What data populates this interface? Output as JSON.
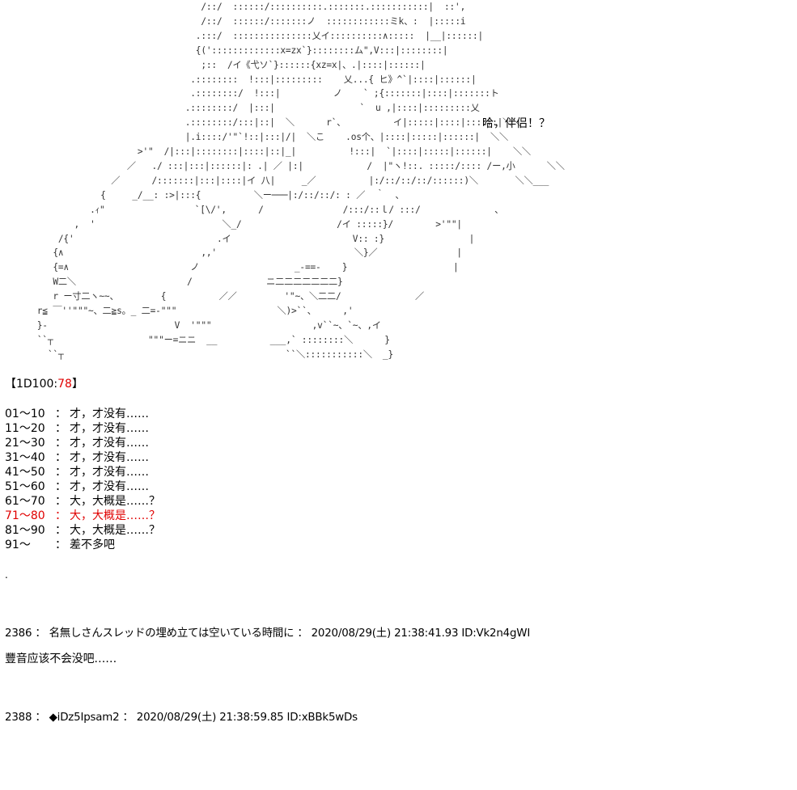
{
  "ascii_art": "                                      /::/  ::::::/::::::::::.:::::::.:::::::::::|  ::',\n                                      /::/  ::::::/:::::::ノ  ::::::::::::ミk、:  |:::::i\n                                     .:::/  :::::::::::::::乂イ::::::::::∧:::::  |__|::::::|\n                                     {(':::::::::::::x=zx`}::::::::ム\",V:::|::::::::|\n                                      ;::  /イ《弋ソ`}::::::{xz=x|、.|::::|::::::|\n                                    .::::::::  !:::|:::::::::    乂...{ ヒ》^`|::::|::::::|\n                                    .::::::::/  !:::|          ノ    ` ;{:::::::|::::|:::::::ト\n                                   .::::::::/  |:::|                `  u ,|::::|:::::::::乂\n                                   .::::::::/:::|::|  ＼      r`、         イ|:::::|::::|::::::|＼＼\n                                   |.i::::/'\"`!::|:::|/|  ＼こ    .os个、|::::|:::::|::::::|  ＼＼\n                          >'\"  /|:::|::::::::|::::|::|_|          !:::|  `|::::|:::::|::::::|    ＼＼\n                        ／   ./ :::|:::|::::::|: .| ／ |:|            /  |\"ヽ!::. :::::/:::: /ー,小      ＼＼\n                     ／      /:::::::|:::|::::|イ 八|     _／          |:/::/::/::/::::::)＼       ＼＼___\n                   {     _/__: :>|:::{          ＼ー───|:/::/::/: : ／  ｀  、\n                 .ｨ\"                 `[\\/',      /               /:::/::ｌ/ :::/              、\n              ,  '                        ＼_/                  /イ :::::}/        >'\"\"|\n           /{'                           .イ                       V:: :}                |\n          {∧                          ,,'                          ＼}／               |\n          {=∧                       ノ                  _-==-    }                    |\n          W二＼                     /              ニ二二二二二二二}\n          r ー寸二ヽ~~、        {          ／／         '\"~、＼二二/              ／\n       r≦ ￣''\"\"\"~、二≧s。_ 二=-\"\"\"                   ＼)>``、     ,'\n       }-                        V  '\"\"\"                   ,v``~、`~、,イ\n       ``┬                  \"\"\"ー=ニニ  __          ___,` ::::::::＼      }\n         ``┬                                          ``＼:::::::::::＼  _}",
  "speech": "哈，伴侣！？",
  "roll": {
    "open": "【1D100:",
    "value": "78",
    "close": "】"
  },
  "table": [
    {
      "range": "01～10",
      "sep": "：",
      "text": "才，才没有……"
    },
    {
      "range": "11～20",
      "sep": "：",
      "text": "才，才没有……"
    },
    {
      "range": "21～30",
      "sep": "：",
      "text": "才，才没有……"
    },
    {
      "range": "31～40",
      "sep": "：",
      "text": "才，才没有……"
    },
    {
      "range": "41～50",
      "sep": "：",
      "text": "才，才没有……"
    },
    {
      "range": "51～60",
      "sep": "：",
      "text": "才，才没有……"
    },
    {
      "range": "61～70",
      "sep": "：",
      "text": "大，大概是……？"
    },
    {
      "range": "71～80",
      "sep": "：",
      "text": "大，大概是……？"
    },
    {
      "range": "81～90",
      "sep": "：",
      "text": "大，大概是……？"
    },
    {
      "range": "91～",
      "sep": "：",
      "text": "差不多吧"
    }
  ],
  "highlight_color": "#e00000",
  "dot": ".",
  "post1": {
    "header": "2386 ： 名無しさんスレッドの埋め立ては空いている時間に ： 2020/08/29(土) 21:38:41.93 ID:Vk2n4gWI",
    "body": "豐音应该不会没吧……"
  },
  "post2": {
    "header": "2388 ： ◆iDz5Ipsam2 ： 2020/08/29(土) 21:38:59.85 ID:xBBk5wDs"
  }
}
